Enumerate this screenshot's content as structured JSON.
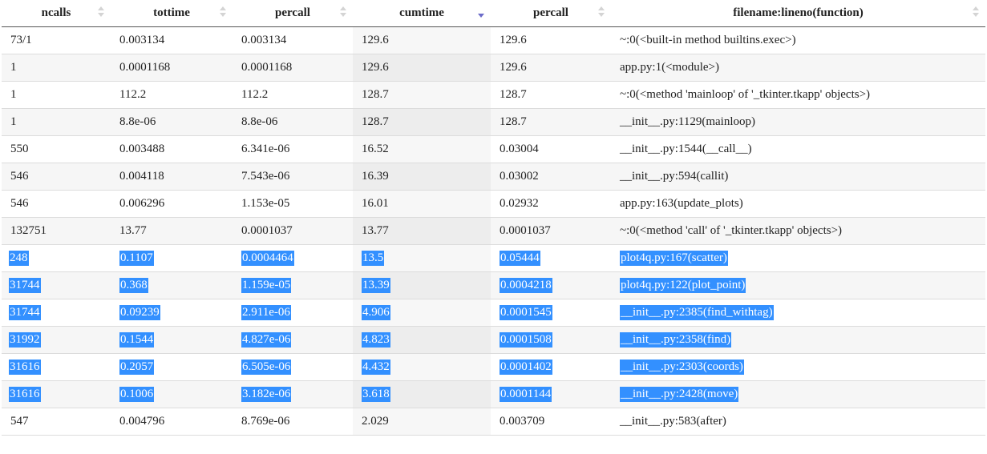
{
  "table": {
    "sort_column": 3,
    "columns": [
      {
        "label": "ncalls"
      },
      {
        "label": "tottime"
      },
      {
        "label": "percall"
      },
      {
        "label": "cumtime"
      },
      {
        "label": "percall"
      },
      {
        "label": "filename:lineno(function)"
      }
    ],
    "rows": [
      {
        "selected": false,
        "cells": [
          "73/1",
          "0.003134",
          "0.003134",
          "129.6",
          "129.6",
          "~:0(<built-in method builtins.exec>)"
        ]
      },
      {
        "selected": false,
        "cells": [
          "1",
          "0.0001168",
          "0.0001168",
          "129.6",
          "129.6",
          "app.py:1(<module>)"
        ]
      },
      {
        "selected": false,
        "cells": [
          "1",
          "112.2",
          "112.2",
          "128.7",
          "128.7",
          "~:0(<method 'mainloop' of '_tkinter.tkapp' objects>)"
        ]
      },
      {
        "selected": false,
        "cells": [
          "1",
          "8.8e-06",
          "8.8e-06",
          "128.7",
          "128.7",
          "__init__.py:1129(mainloop)"
        ]
      },
      {
        "selected": false,
        "cells": [
          "550",
          "0.003488",
          "6.341e-06",
          "16.52",
          "0.03004",
          "__init__.py:1544(__call__)"
        ]
      },
      {
        "selected": false,
        "cells": [
          "546",
          "0.004118",
          "7.543e-06",
          "16.39",
          "0.03002",
          "__init__.py:594(callit)"
        ]
      },
      {
        "selected": false,
        "cells": [
          "546",
          "0.006296",
          "1.153e-05",
          "16.01",
          "0.02932",
          "app.py:163(update_plots)"
        ]
      },
      {
        "selected": false,
        "cells": [
          "132751",
          "13.77",
          "0.0001037",
          "13.77",
          "0.0001037",
          "~:0(<method 'call' of '_tkinter.tkapp' objects>)"
        ]
      },
      {
        "selected": true,
        "cells": [
          "248",
          "0.1107",
          "0.0004464",
          "13.5",
          "0.05444",
          "plot4q.py:167(scatter)"
        ]
      },
      {
        "selected": true,
        "cells": [
          "31744",
          "0.368",
          "1.159e-05",
          "13.39",
          "0.0004218",
          "plot4q.py:122(plot_point)"
        ]
      },
      {
        "selected": true,
        "cells": [
          "31744",
          "0.09239",
          "2.911e-06",
          "4.906",
          "0.0001545",
          "__init__.py:2385(find_withtag)"
        ]
      },
      {
        "selected": true,
        "cells": [
          "31992",
          "0.1544",
          "4.827e-06",
          "4.823",
          "0.0001508",
          "__init__.py:2358(find)"
        ]
      },
      {
        "selected": true,
        "cells": [
          "31616",
          "0.2057",
          "6.505e-06",
          "4.432",
          "0.0001402",
          "__init__.py:2303(coords)"
        ]
      },
      {
        "selected": true,
        "cells": [
          "31616",
          "0.1006",
          "3.182e-06",
          "3.618",
          "0.0001144",
          "__init__.py:2428(move)"
        ]
      },
      {
        "selected": false,
        "cells": [
          "547",
          "0.004796",
          "8.769e-06",
          "2.029",
          "0.003709",
          "__init__.py:583(after)"
        ]
      }
    ]
  }
}
